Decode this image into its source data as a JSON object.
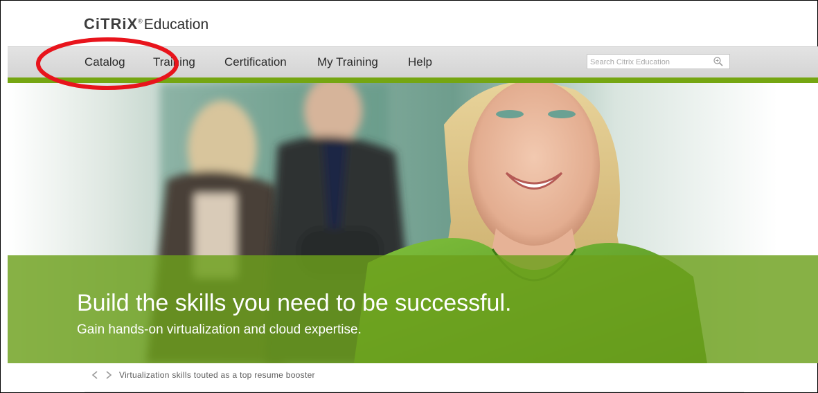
{
  "brand": {
    "logo_text": "CiTRiX",
    "logo_mark": "®",
    "name": "Education"
  },
  "nav": {
    "items": [
      {
        "label": "Catalog"
      },
      {
        "label": "Training"
      },
      {
        "label": "Certification"
      },
      {
        "label": "My Training"
      },
      {
        "label": "Help"
      }
    ],
    "search": {
      "placeholder": "Search Citrix Education",
      "icon": "search-zoom-icon"
    }
  },
  "hero": {
    "title": "Build the skills you need to be successful.",
    "subtitle": "Gain hands-on virtualization and cloud expertise."
  },
  "ticker": {
    "prev_icon": "chevron-left-icon",
    "next_icon": "chevron-right-icon",
    "headline": "Virtualization skills touted as a top resume booster"
  },
  "colors": {
    "accent_green": "#75a612",
    "band_green": "#6ca01c",
    "annotation_red": "#e8141c",
    "nav_bg": "#dcdcdc"
  }
}
